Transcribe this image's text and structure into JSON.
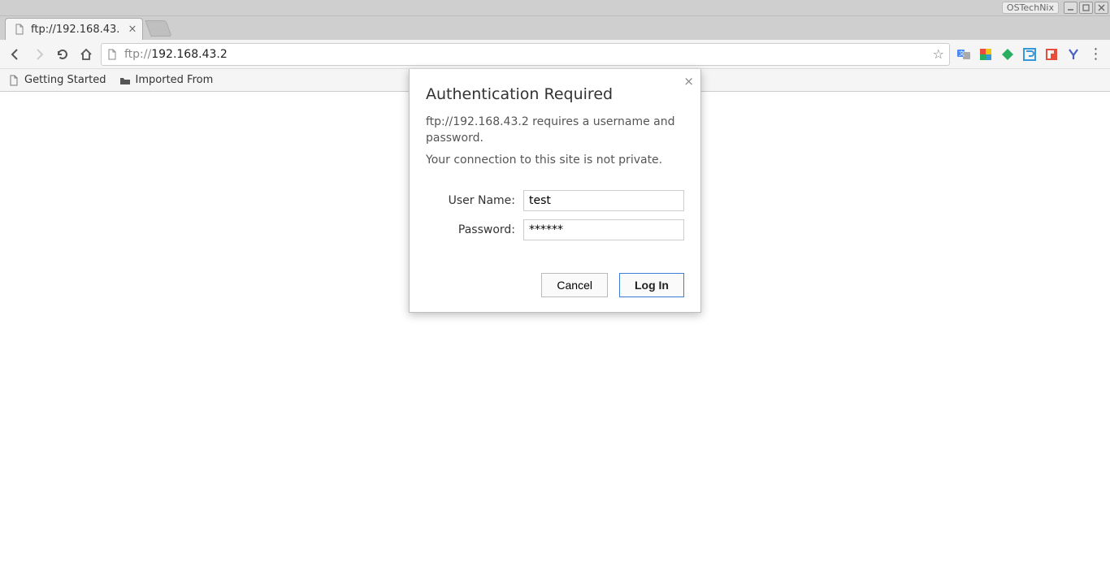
{
  "window": {
    "watermark": "OSTechNix"
  },
  "tab": {
    "title": "ftp://192.168.43."
  },
  "url": {
    "protocol": "ftp://",
    "host": "192.168.43.2"
  },
  "bookmarks": {
    "item1": "Getting Started",
    "item2": "Imported From"
  },
  "extensions": {
    "translate": "translate-icon",
    "puzzle": "puzzle-icon",
    "diamond": "diamond-icon",
    "bluesquare": "blue-icon",
    "flipboard": "flipboard-icon",
    "vimeo": "vymeo-icon"
  },
  "dialog": {
    "title": "Authentication Required",
    "message1": "ftp://192.168.43.2 requires a username and password.",
    "message2": "Your connection to this site is not private.",
    "labels": {
      "username": "User Name:",
      "password": "Password:"
    },
    "values": {
      "username": "test",
      "password": "******"
    },
    "buttons": {
      "cancel": "Cancel",
      "login": "Log In"
    }
  }
}
